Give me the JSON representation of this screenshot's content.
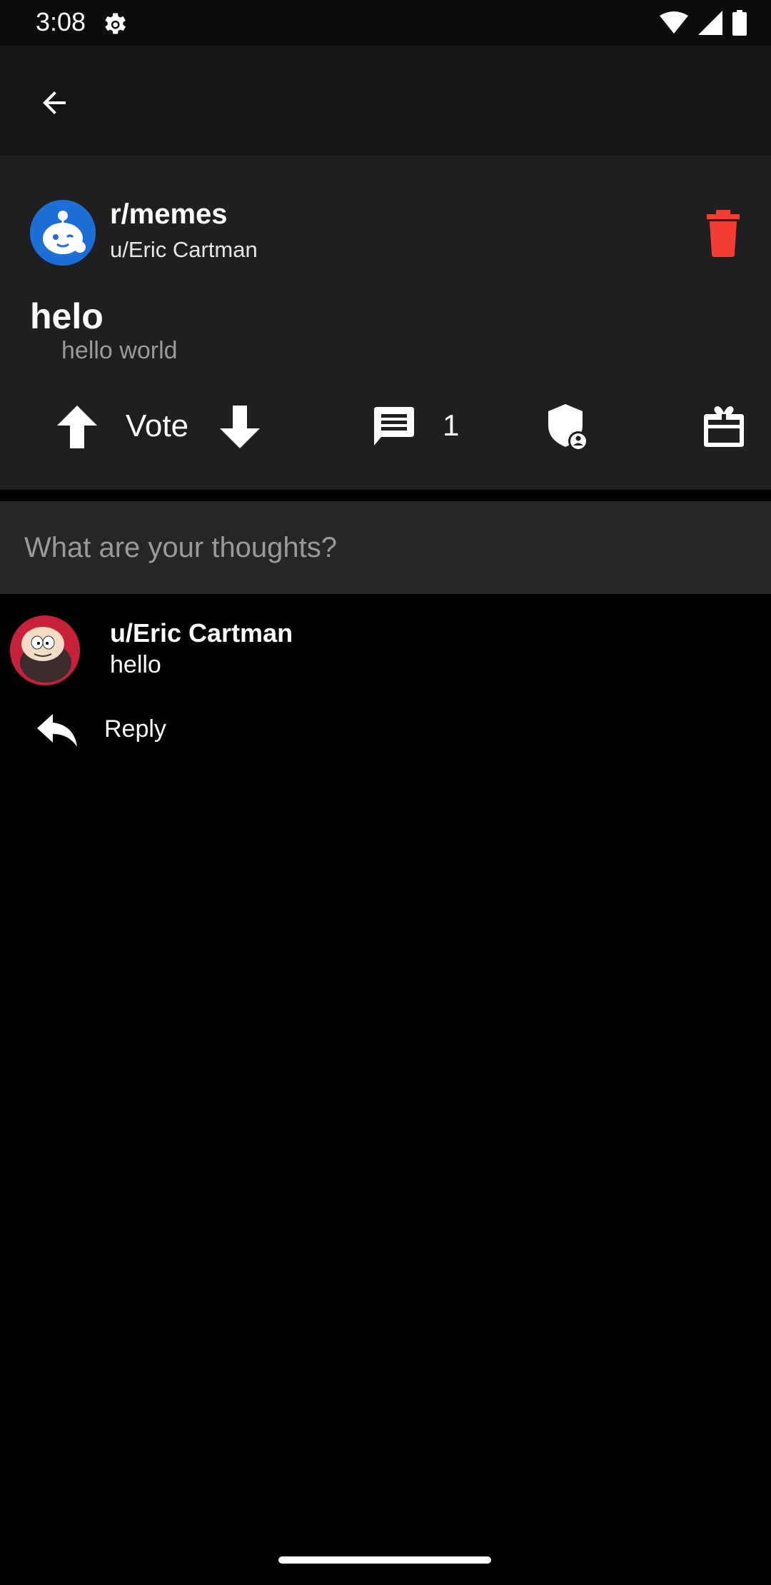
{
  "status_bar": {
    "time": "3:08",
    "icons": [
      "settings-gear-icon",
      "wifi-icon",
      "signal-icon",
      "battery-icon"
    ]
  },
  "app_bar": {
    "back_icon": "arrow-back-icon"
  },
  "post": {
    "subreddit": "r/memes",
    "author": "u/Eric Cartman",
    "title": "helo",
    "body": "hello world",
    "vote_label": "Vote",
    "comment_count": "1",
    "delete_color": "#f23c34",
    "icons": [
      "arrow-up-icon",
      "arrow-down-icon",
      "comment-icon",
      "mod-shield-icon",
      "gift-award-icon",
      "trash-icon"
    ]
  },
  "comment_box": {
    "placeholder": "What are your thoughts?"
  },
  "comments": [
    {
      "author": "u/Eric Cartman",
      "text": "hello",
      "reply_label": "Reply"
    }
  ]
}
